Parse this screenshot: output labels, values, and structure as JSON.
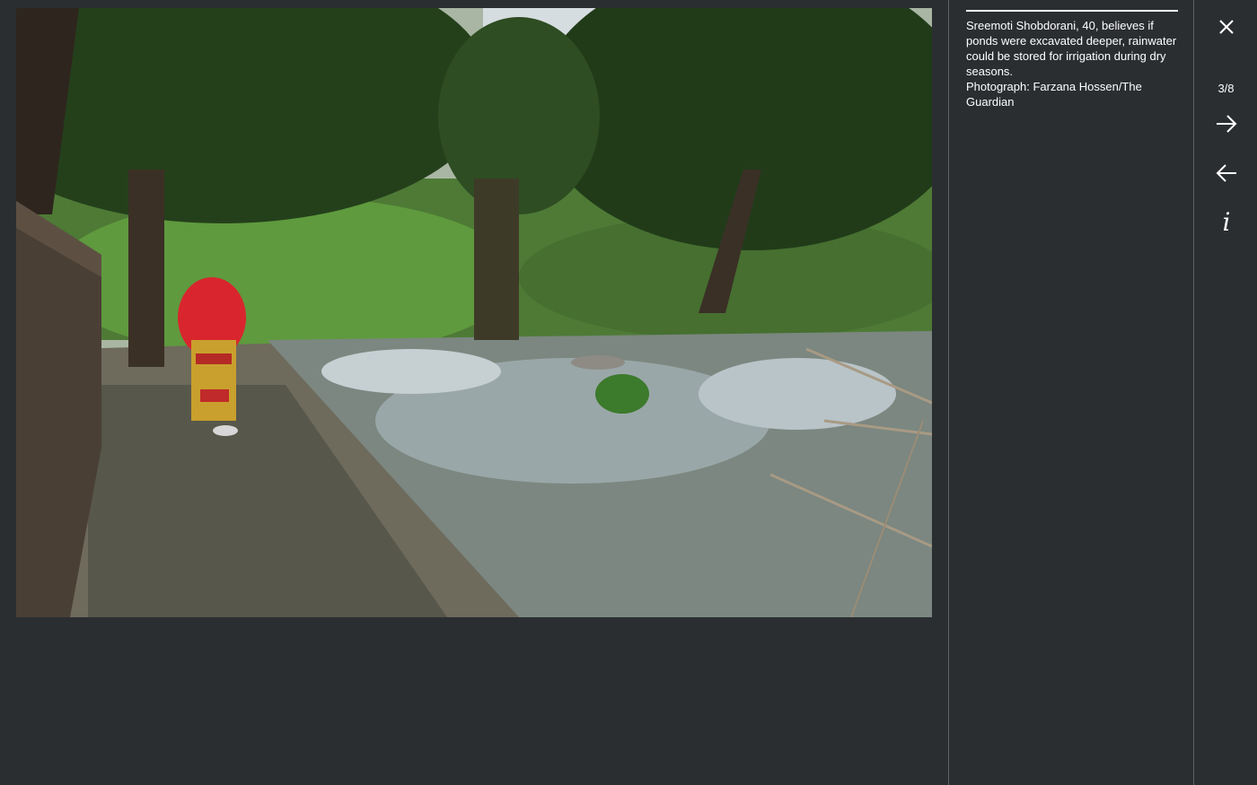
{
  "gallery": {
    "counter": "3/8",
    "caption": "Sreemoti Shobdorani, 40, believes if ponds were excavated deeper, rainwater could be stored for irrigation during dry seasons.",
    "credit": "Photograph: Farzana Hossen/The Guardian"
  },
  "controls": {
    "close_icon": "close-icon",
    "next_icon": "arrow-right-icon",
    "prev_icon": "arrow-left-icon",
    "info_icon": "info-icon",
    "info_glyph": "i"
  },
  "colors": {
    "background": "#2b2e31",
    "divider": "#5e6368",
    "text": "#ffffff"
  }
}
